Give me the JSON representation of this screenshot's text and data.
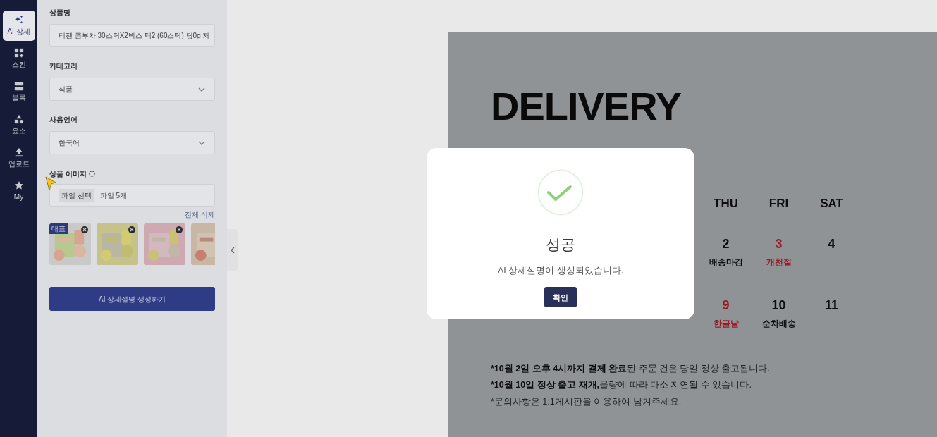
{
  "sidebar": {
    "items": [
      {
        "label": "AI 상세",
        "selected": true
      },
      {
        "label": "스킨",
        "selected": false
      },
      {
        "label": "블록",
        "selected": false
      },
      {
        "label": "요소",
        "selected": false
      },
      {
        "label": "업로드",
        "selected": false
      },
      {
        "label": "My",
        "selected": false
      }
    ]
  },
  "form": {
    "product_name": {
      "label": "상품명",
      "value": "티젠 콤부차 30스틱X2박스 택2 (60스틱) 당0g 저"
    },
    "category": {
      "label": "카테고리",
      "value": "식품"
    },
    "language": {
      "label": "사용언어",
      "value": "한국어"
    },
    "images": {
      "label": "상품 이미지",
      "file_button": "파일 선택",
      "file_count": "파일 5개",
      "delete_all": "전체 삭제",
      "thumbnails": [
        {
          "kind": "picture",
          "badge": "대표",
          "removable": true
        },
        {
          "kind": "picture",
          "removable": true
        },
        {
          "kind": "picture",
          "removable": true
        },
        {
          "kind": "picture"
        }
      ]
    },
    "generate_button": "AI 상세설명 생성하기"
  },
  "preview": {
    "title_lines": [
      "DELIVERY"
    ],
    "weekdays": [
      "THU",
      "FRI",
      "SAT"
    ],
    "weeks": [
      [
        {
          "day": "2",
          "note": "배송마감",
          "holiday": false
        },
        {
          "day": "3",
          "note": "개천절",
          "holiday": true
        },
        {
          "day": "4",
          "holiday": false
        }
      ],
      [
        {
          "day": "9",
          "note": "한글날",
          "holiday": true
        },
        {
          "day": "10",
          "note": "순차배송",
          "holiday": false
        },
        {
          "day": "11",
          "holiday": false
        }
      ]
    ],
    "notes": [
      {
        "bold": "*10월 2일 오후 4시까지 결제 완료",
        "text": "된 주문 건은 당일 정상 출고됩니다."
      },
      {
        "bold": "*10월 10일 정상 출고 재개,",
        "text": "물량에 따라 다소 지연될 수 있습니다."
      },
      {
        "text": "*문의사항은 1:1게시판을 이용하여 남겨주세요."
      }
    ]
  },
  "modal": {
    "title": "성공",
    "message": "AI 상세설명이 생성되었습니다.",
    "button": "확인"
  }
}
